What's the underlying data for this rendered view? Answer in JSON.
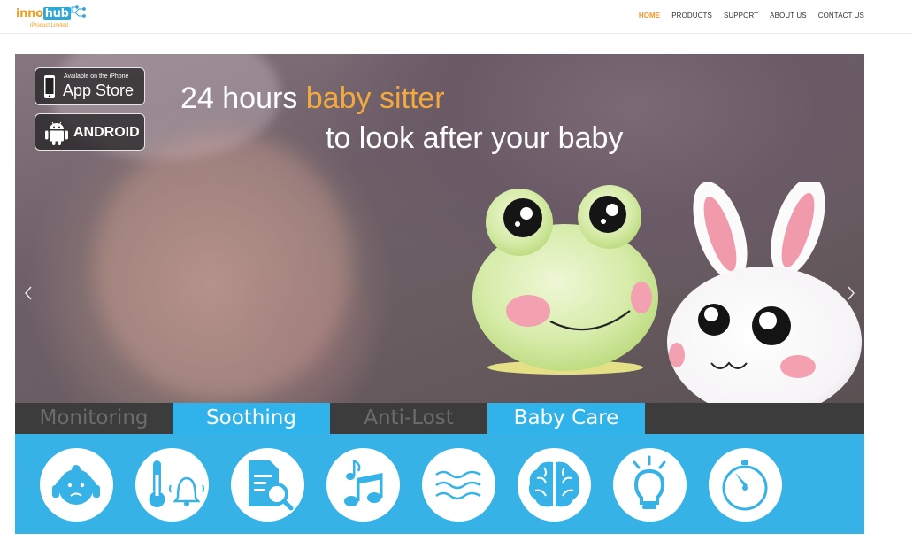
{
  "brand": {
    "logo_part1": "inno",
    "logo_part2": "hub",
    "tagline": "iProduct Limited"
  },
  "nav": {
    "items": [
      {
        "label": "HOME",
        "active": true
      },
      {
        "label": "PRODUCTS",
        "active": false
      },
      {
        "label": "SUPPORT",
        "active": false
      },
      {
        "label": "ABOUT US",
        "active": false
      },
      {
        "label": "CONTACT US",
        "active": false
      }
    ]
  },
  "hero": {
    "app_store_small": "Available on the iPhone",
    "app_store_big": "App Store",
    "android_label": "ANDROID",
    "headline_part1": "24 hours ",
    "headline_highlight": "baby sitter",
    "headline_line2": "to look after your baby",
    "highlight_color": "#f3a93b"
  },
  "tabs": [
    {
      "label": "Monitoring",
      "active": false
    },
    {
      "label": "Soothing",
      "active": true
    },
    {
      "label": "Anti-Lost",
      "active": false
    },
    {
      "label": "Baby Care",
      "active": true
    }
  ],
  "features": {
    "icons": [
      "baby-face-icon",
      "thermometer-bell-icon",
      "document-search-icon",
      "music-notes-icon",
      "waves-icon",
      "brain-icon",
      "light-bulb-icon",
      "timer-icon"
    ]
  },
  "colors": {
    "accent_orange": "#f0962d",
    "tab_blue": "#2fb3ea",
    "feature_bar": "#36b2e6",
    "tab_bar_dark": "#3c3c3c"
  }
}
